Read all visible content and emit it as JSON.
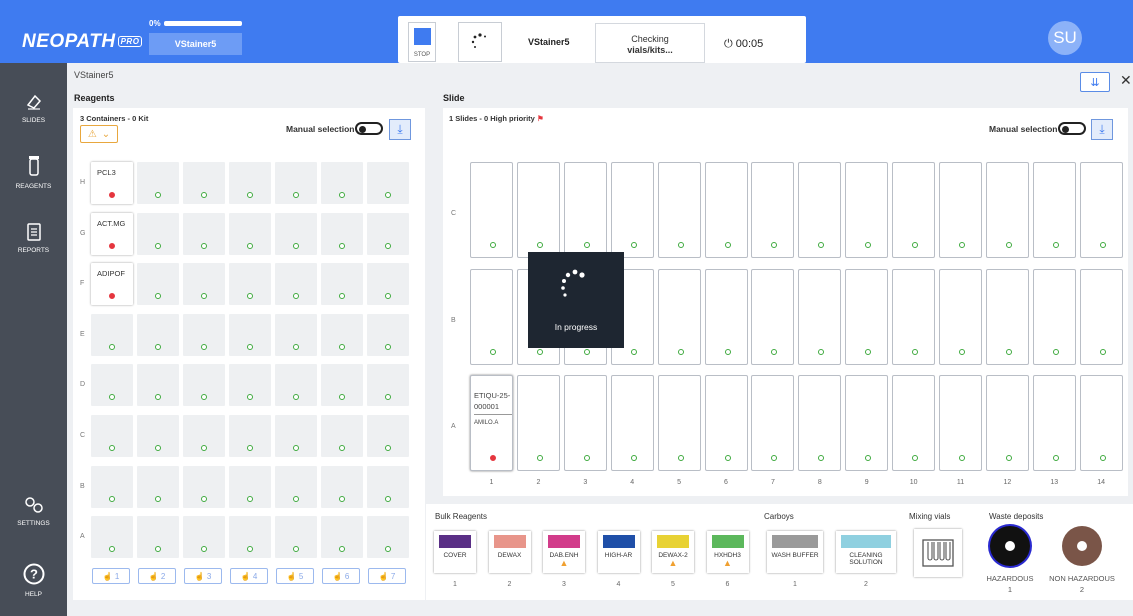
{
  "topbar": {
    "logo": "NEOPATH",
    "logo_badge": "PRO",
    "progress_pct": "0%",
    "progress_value": 0,
    "instrument_button": "VStainer5",
    "stop_label": "STOP",
    "instrument_name": "VStainer5",
    "status_line1": "Checking",
    "status_line2": "vials/kits...",
    "timer": "⏻ 00:05",
    "avatar": "SU"
  },
  "sidebar": {
    "items": [
      {
        "label": "SLIDES",
        "icon": "eraser-icon"
      },
      {
        "label": "REAGENTS",
        "icon": "vial-icon"
      },
      {
        "label": "REPORTS",
        "icon": "report-icon"
      },
      {
        "label": "SETTINGS",
        "icon": "gears-icon"
      },
      {
        "label": "HELP",
        "icon": "help-icon"
      }
    ]
  },
  "breadcrumb": "VStainer5",
  "reagents": {
    "heading": "Reagents",
    "info": "3 Containers - 0 Kit",
    "manual_label": "Manual selection",
    "rows": [
      "H",
      "G",
      "F",
      "E",
      "D",
      "C",
      "B",
      "A"
    ],
    "filled": [
      {
        "row": "H",
        "label": "PCL3"
      },
      {
        "row": "G",
        "label": "ACT.MG"
      },
      {
        "row": "F",
        "label": "ADIPOF"
      }
    ],
    "hand_buttons": [
      "1",
      "2",
      "3",
      "4",
      "5",
      "6",
      "7"
    ]
  },
  "slides": {
    "heading": "Slide",
    "info": "1 Slides - 0 High priority",
    "manual_label": "Manual selection",
    "rows": [
      "C",
      "B",
      "A"
    ],
    "columns": [
      "1",
      "2",
      "3",
      "4",
      "5",
      "6",
      "7",
      "8",
      "9",
      "10",
      "11",
      "12",
      "13",
      "14"
    ],
    "filled_slide": {
      "id_line1": "ETIQU-25-",
      "id_line2": "000001",
      "reagent": "AMILO.A"
    },
    "overlay_text": "In progress"
  },
  "bulk": {
    "heading": "Bulk Reagents",
    "items": [
      {
        "name": "COVER",
        "color": "#5a2f86",
        "warn": false,
        "num": "1"
      },
      {
        "name": "DEWAX",
        "color": "#e8958a",
        "warn": false,
        "num": "2"
      },
      {
        "name": "DAB.ENH",
        "color": "#d23c8a",
        "warn": true,
        "num": "3"
      },
      {
        "name": "HIGH-AR",
        "color": "#1f4fa8",
        "warn": false,
        "num": "4"
      },
      {
        "name": "DEWAX-2",
        "color": "#e8d234",
        "warn": true,
        "num": "5"
      },
      {
        "name": "HXHDH3",
        "color": "#5cb85c",
        "warn": true,
        "num": "6"
      }
    ]
  },
  "carboys": {
    "heading": "Carboys",
    "items": [
      {
        "name": "WASH BUFFER",
        "color": "#9a9a9a",
        "num": "1"
      },
      {
        "name_line1": "CLEANING",
        "name_line2": "SOLUTION",
        "color": "#8fd0e0",
        "num": "2"
      }
    ]
  },
  "mixing": {
    "heading": "Mixing vials"
  },
  "waste": {
    "heading": "Waste deposits",
    "items": [
      {
        "name": "HAZARDOUS",
        "num": "1",
        "color": "#111111"
      },
      {
        "name": "NON HAZARDOUS",
        "num": "2",
        "color": "#7a5548"
      }
    ]
  }
}
